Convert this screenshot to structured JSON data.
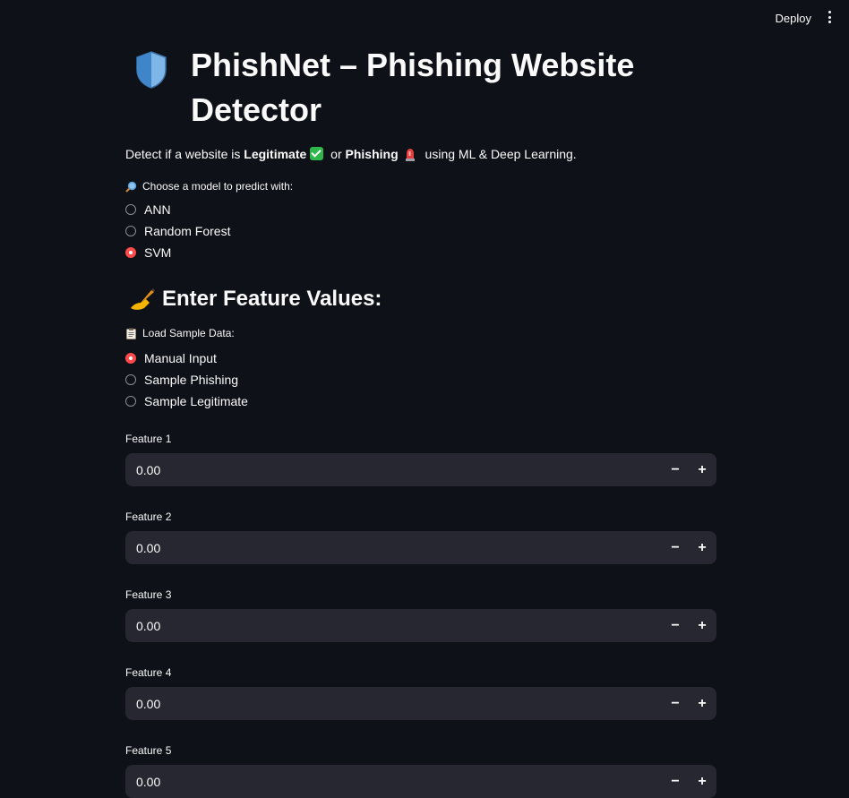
{
  "header": {
    "deploy_label": "Deploy",
    "menu_icon": "kebab-menu-icon"
  },
  "page": {
    "title_icon": "shield-icon",
    "title": "PhishNet – Phishing Website Detector",
    "description": {
      "prefix": "Detect if a website is ",
      "legit": "Legitimate",
      "legit_icon": "check-mark-icon",
      "mid": " or ",
      "phish": "Phishing",
      "phish_icon": "siren-icon",
      "suffix": " using ML & Deep Learning."
    }
  },
  "model_select": {
    "icon": "magnifier-icon",
    "label": "Choose a model to predict with:",
    "options": [
      "ANN",
      "Random Forest",
      "SVM"
    ],
    "selected": "SVM"
  },
  "features_section": {
    "icon": "writing-hand-icon",
    "heading": "Enter Feature Values:"
  },
  "sample_select": {
    "icon": "clipboard-icon",
    "label": "Load Sample Data:",
    "options": [
      "Manual Input",
      "Sample Phishing",
      "Sample Legitimate"
    ],
    "selected": "Manual Input"
  },
  "features": [
    {
      "label": "Feature 1",
      "value": "0.00"
    },
    {
      "label": "Feature 2",
      "value": "0.00"
    },
    {
      "label": "Feature 3",
      "value": "0.00"
    },
    {
      "label": "Feature 4",
      "value": "0.00"
    },
    {
      "label": "Feature 5",
      "value": "0.00"
    }
  ],
  "stepper": {
    "minus": "−",
    "plus": "+"
  },
  "colors": {
    "background": "#0e1117",
    "input_bg": "#262730",
    "accent": "#ff4b4b",
    "text": "#fafafa"
  }
}
